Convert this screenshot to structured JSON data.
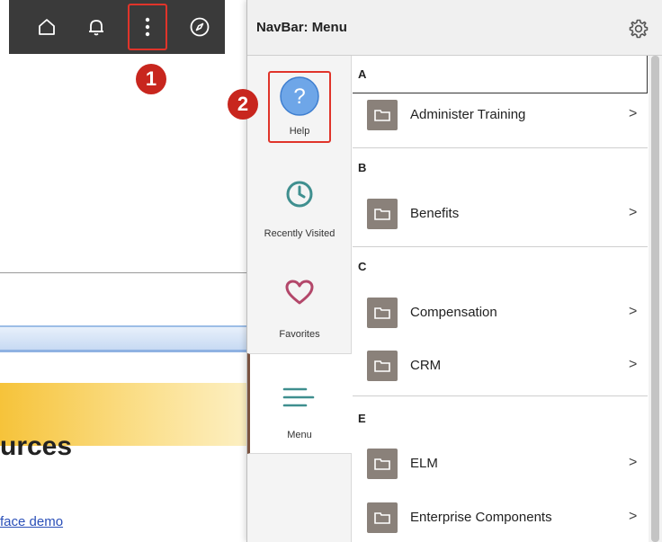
{
  "topbar": {
    "icons": [
      "home-icon",
      "bell-icon",
      "more-vertical-icon",
      "compass-icon"
    ]
  },
  "callouts": {
    "one": "1",
    "two": "2"
  },
  "background": {
    "heading": "urces",
    "link": "face demo"
  },
  "navbar": {
    "title": "NavBar: Menu",
    "settings_icon": "gear-icon",
    "side": {
      "help": {
        "label": "Help",
        "glyph": "?"
      },
      "recent": {
        "label": "Recently Visited"
      },
      "favorites": {
        "label": "Favorites"
      },
      "menu": {
        "label": "Menu"
      }
    },
    "groups": [
      {
        "letter": "A",
        "items": [
          "Administer Training"
        ]
      },
      {
        "letter": "B",
        "items": [
          "Benefits"
        ]
      },
      {
        "letter": "C",
        "items": [
          "Compensation",
          "CRM"
        ]
      },
      {
        "letter": "E",
        "items": [
          "ELM",
          "Enterprise Components"
        ]
      }
    ],
    "chevron": ">"
  },
  "colors": {
    "topbar": "#3a3a3a",
    "callout": "#c8261e",
    "highlight": "#e0342a",
    "help_blue": "#6ea6e8",
    "teal": "#3f8f8f",
    "heart": "#b3476a",
    "folder": "#8a817a"
  }
}
